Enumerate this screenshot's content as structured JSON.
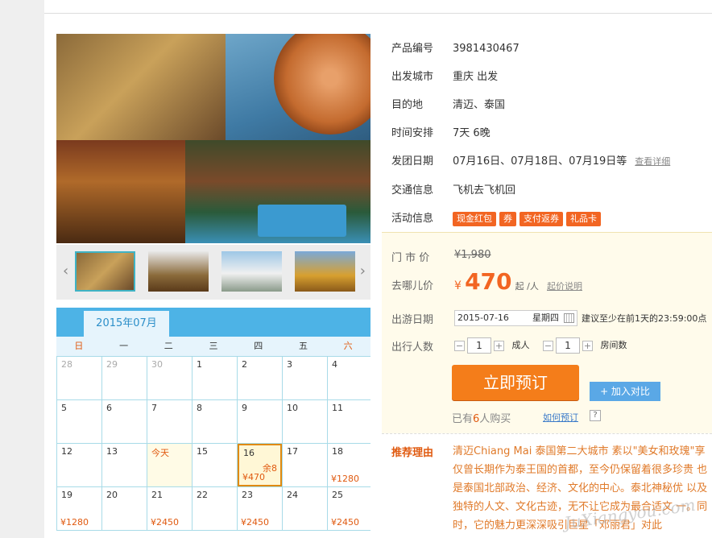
{
  "product": {
    "rows": [
      {
        "label": "产品编号",
        "value": "3981430467"
      },
      {
        "label": "出发城市",
        "value": "重庆 出发"
      },
      {
        "label": "目的地",
        "value": "清迈、泰国"
      },
      {
        "label": "时间安排",
        "value": "7天 6晚"
      },
      {
        "label": "发团日期",
        "value": "07月16日、07月18日、07月19日等",
        "link": "查看详细"
      },
      {
        "label": "交通信息",
        "value": "飞机去飞机回"
      },
      {
        "label": "活动信息"
      }
    ],
    "tags": [
      "现金红包",
      "券",
      "支付返券",
      "礼品卡"
    ]
  },
  "price": {
    "market_label": "门 市 价",
    "market_value": "¥1,980",
    "qunar_label": "去哪儿价",
    "currency": "¥",
    "amount": "470",
    "unit": "起 /人",
    "explain_link": "起价说明"
  },
  "booking": {
    "date_label": "出游日期",
    "date_value": "2015-07-16",
    "weekday": "星期四",
    "hint": "建议至少在前1天的23:59:00点",
    "people_label": "出行人数",
    "adults": "1",
    "adult_unit": "成人",
    "rooms": "1",
    "room_unit": "房间数",
    "minus": "−",
    "plus": "+",
    "book_button": "立即预订",
    "compare_button": "+ 加入对比",
    "sold_prefix": "已有",
    "sold_count": "6",
    "sold_suffix": "人购买",
    "how_link": "如何预订",
    "help": "?"
  },
  "recommend": {
    "label": "推荐理由",
    "text": "清迈Chiang Mai 泰国第二大城市 素以\"美女和玫瑰\"享 仅曾长期作为泰王国的首都，至今仍保留着很多珍贵 也是泰国北部政治、经济、文化的中心。泰北神秘优 以及独特的人文、文化古迹，无不让它成为最合适文 一。同时，它的魅力更深深吸引巨星「邓丽君」对此",
    "watermark": "JuXiangyou.com"
  },
  "calendar": {
    "month_tab": "2015年07月",
    "weekdays": [
      "日",
      "一",
      "二",
      "三",
      "四",
      "五",
      "六"
    ],
    "cells": [
      {
        "day": "28",
        "muted": true
      },
      {
        "day": "29",
        "muted": true
      },
      {
        "day": "30",
        "muted": true
      },
      {
        "day": "1"
      },
      {
        "day": "2"
      },
      {
        "day": "3"
      },
      {
        "day": "4"
      },
      {
        "day": "5"
      },
      {
        "day": "6"
      },
      {
        "day": "7"
      },
      {
        "day": "8"
      },
      {
        "day": "9"
      },
      {
        "day": "10"
      },
      {
        "day": "11"
      },
      {
        "day": "12"
      },
      {
        "day": "13"
      },
      {
        "day": "今天",
        "today": true
      },
      {
        "day": "15"
      },
      {
        "day": "16",
        "selected": true,
        "remain": "余8",
        "price": "¥470"
      },
      {
        "day": "17"
      },
      {
        "day": "18",
        "price": "¥1280"
      },
      {
        "day": "19",
        "price": "¥1280"
      },
      {
        "day": "20"
      },
      {
        "day": "21",
        "price": "¥2450"
      },
      {
        "day": "22"
      },
      {
        "day": "23",
        "price": "¥2450"
      },
      {
        "day": "24"
      },
      {
        "day": "25",
        "price": "¥2450"
      }
    ]
  }
}
